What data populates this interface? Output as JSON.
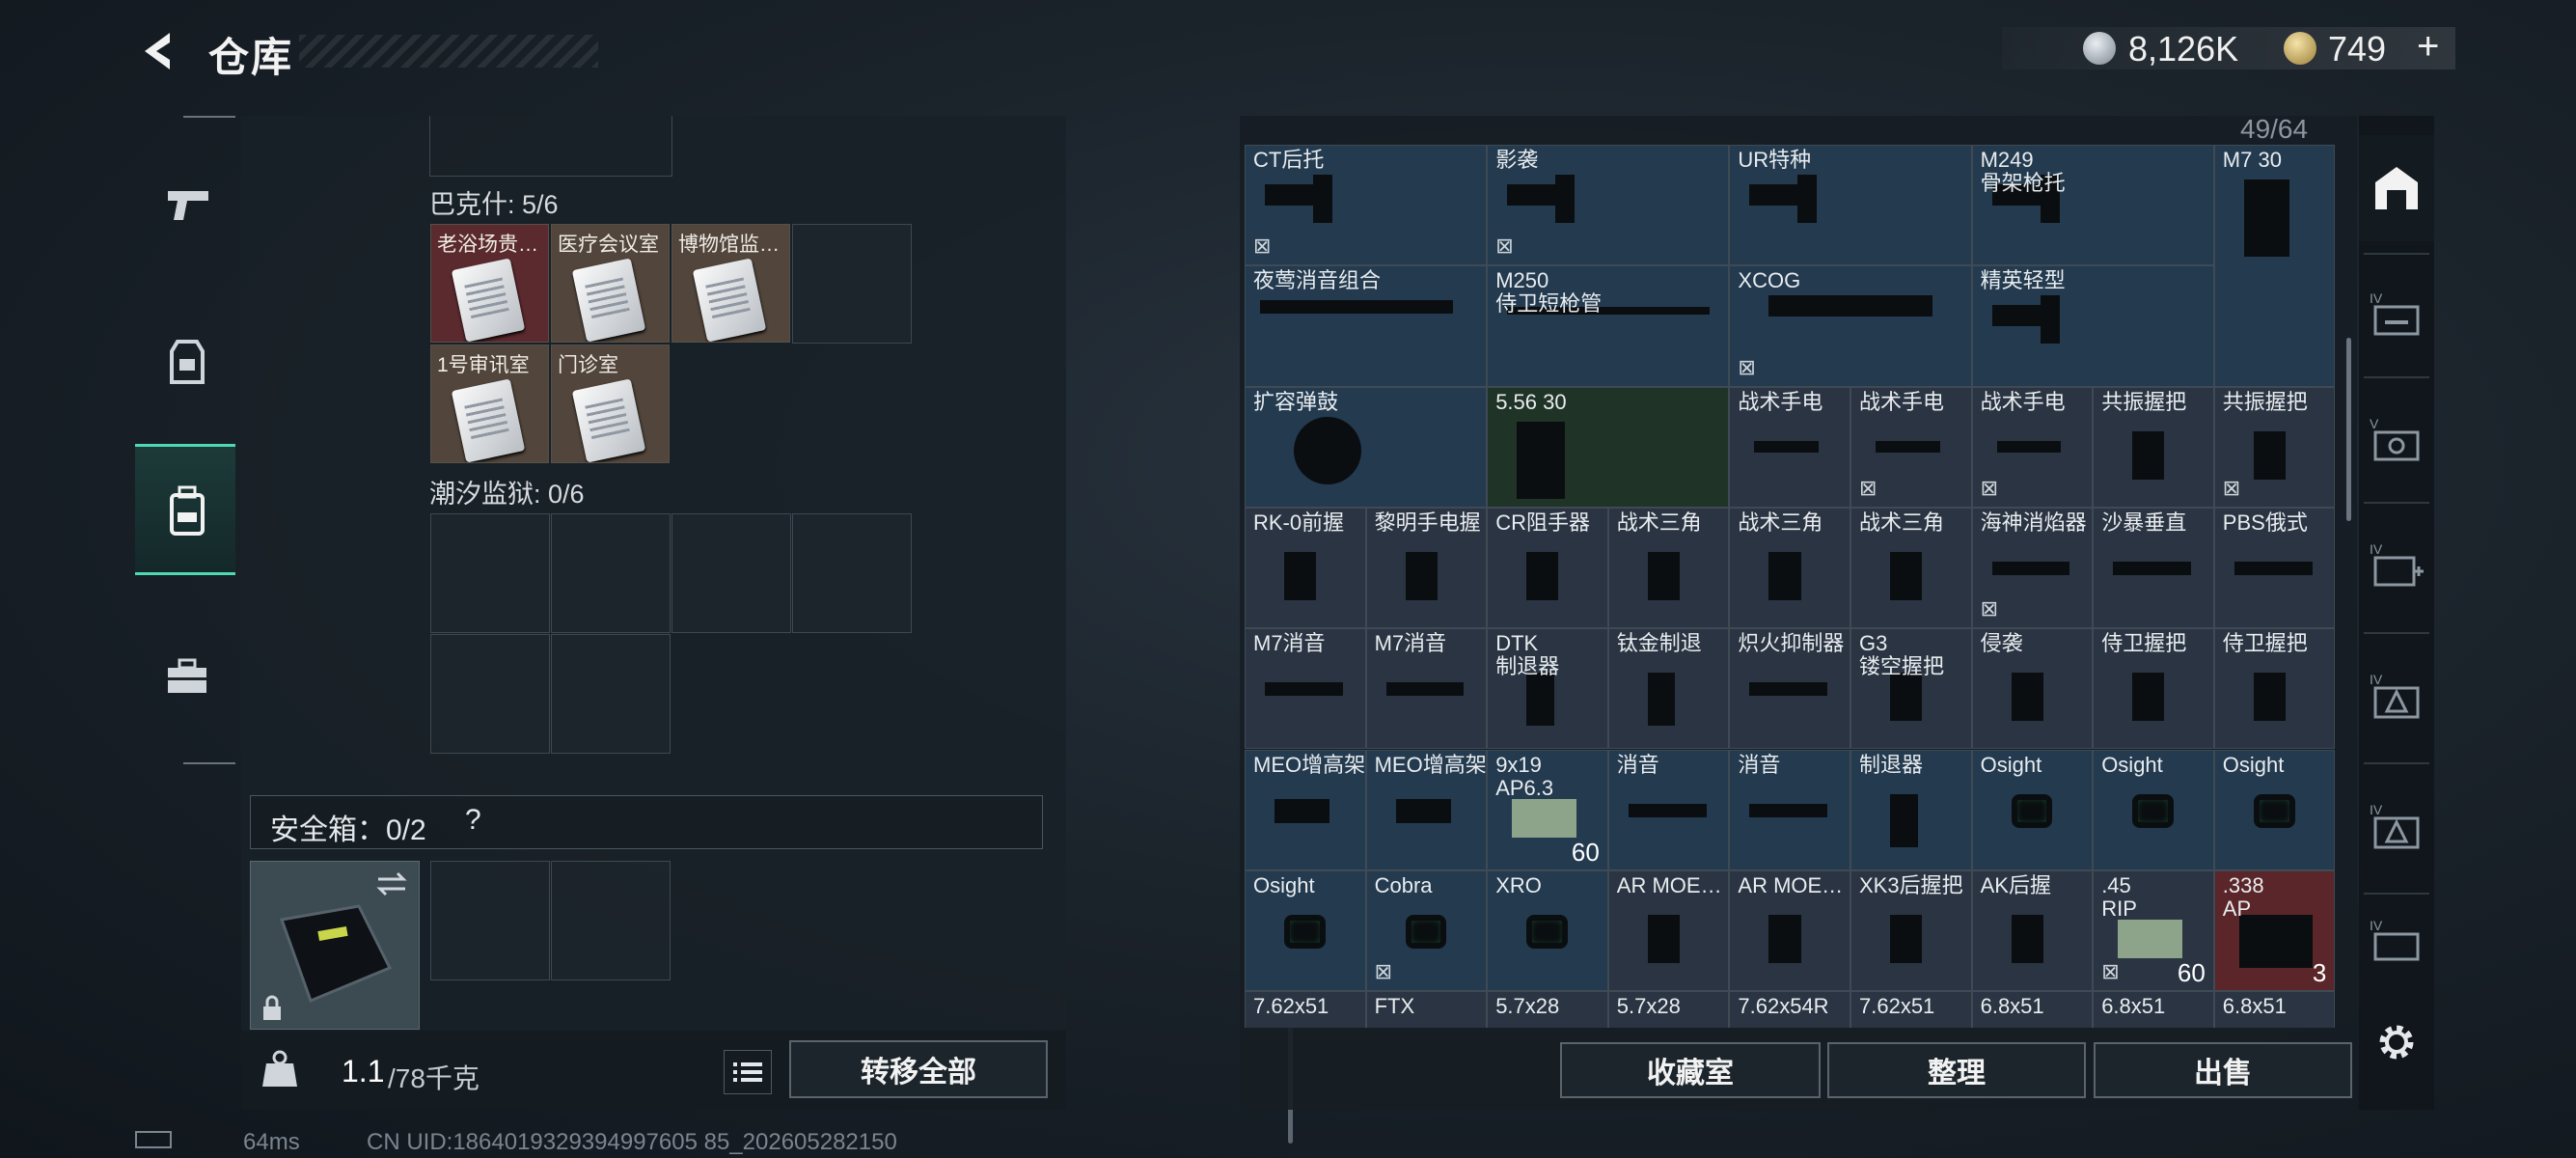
{
  "header": {
    "title": "仓库",
    "back_label": "back"
  },
  "currency": [
    {
      "icon": "silver-coin-icon",
      "value": "8,126K"
    },
    {
      "icon": "gold-coin-icon",
      "value": "749",
      "add": "+"
    }
  ],
  "nav": [
    {
      "name": "weapons",
      "icon": "pistol-icon"
    },
    {
      "name": "equipment",
      "icon": "vest-icon"
    },
    {
      "name": "storage",
      "icon": "backpack-icon",
      "active": true
    },
    {
      "name": "cases",
      "icon": "toolbox-icon"
    }
  ],
  "left": {
    "groups": [
      {
        "title": "巴克什: 5/6",
        "items": [
          "老浴场贵…",
          "医疗会议室",
          "博物馆监…",
          "1号审讯室",
          "门诊室"
        ]
      },
      {
        "title": "潮汐监狱: 0/6"
      }
    ],
    "safe_label": "安全箱：0/2",
    "safe_help": "?",
    "weight_main": "1.1",
    "weight_rest": "/78千克",
    "transfer_all": "转移全部"
  },
  "grid": {
    "count": "49/64",
    "cells": [
      {
        "name": "CT后托"
      },
      {
        "name": "影袭"
      },
      {
        "name": "UR特种"
      },
      {
        "name": "M249\n骨架枪托"
      },
      {
        "name": "M7 30"
      },
      {
        "name": "夜莺消音组合"
      },
      {
        "name": "M250\n侍卫短枪管"
      },
      {
        "name": "XCOG"
      },
      {
        "name": "精英轻型"
      },
      {
        "name": "扩容弹鼓"
      },
      {
        "name": "5.56 30"
      },
      {
        "name": "战术手电"
      },
      {
        "name": "战术手电"
      },
      {
        "name": "战术手电"
      },
      {
        "name": "共振握把"
      },
      {
        "name": "共振握把"
      },
      {
        "name": "RK-0前握"
      },
      {
        "name": "黎明手电握"
      },
      {
        "name": "CR阻手器"
      },
      {
        "name": "战术三角"
      },
      {
        "name": "战术三角"
      },
      {
        "name": "战术三角"
      },
      {
        "name": "海神消焰器"
      },
      {
        "name": "沙暴垂直"
      },
      {
        "name": "PBS俄式"
      },
      {
        "name": "M7消音"
      },
      {
        "name": "M7消音"
      },
      {
        "name": "DTK\n制退器"
      },
      {
        "name": "钛金制退"
      },
      {
        "name": "炽火抑制器"
      },
      {
        "name": "G3\n镂空握把"
      },
      {
        "name": "侵袭"
      },
      {
        "name": "侍卫握把"
      },
      {
        "name": "侍卫握把"
      },
      {
        "name": "MEO增高架"
      },
      {
        "name": "MEO增高架"
      },
      {
        "name": "9x19\nAP6.3",
        "qty": "60"
      },
      {
        "name": "消音"
      },
      {
        "name": "消音"
      },
      {
        "name": "制退器"
      },
      {
        "name": "Osight"
      },
      {
        "name": "Osight"
      },
      {
        "name": "Osight"
      },
      {
        "name": "Osight"
      },
      {
        "name": "Cobra"
      },
      {
        "name": "XRO"
      },
      {
        "name": "AR MOE…"
      },
      {
        "name": "AR MOE…"
      },
      {
        "name": "XK3后握把"
      },
      {
        "name": "AK后握"
      },
      {
        "name": ".45\nRIP",
        "qty": "60"
      },
      {
        "name": ".338\nAP",
        "qty": "3"
      },
      {
        "name": "7.62x51"
      },
      {
        "name": "FTX"
      },
      {
        "name": "5.7x28"
      },
      {
        "name": "5.7x28"
      },
      {
        "name": "7.62x54R"
      },
      {
        "name": "7.62x51"
      },
      {
        "name": "6.8x51"
      },
      {
        "name": "6.8x51"
      },
      {
        "name": "6.8x51"
      }
    ]
  },
  "actions": [
    "收藏室",
    "整理",
    "出售"
  ],
  "sidebar_right": [
    "home-base-icon",
    "iv-armory-icon",
    "iv-vault-icon",
    "iv-medkit-icon",
    "iv-warning-icon",
    "iv-warning-icon",
    "iv-crate-icon",
    "settings-icon"
  ],
  "status": {
    "ping": "64ms",
    "uid": "CN UID:1864019329394997605 85_202605282150"
  }
}
